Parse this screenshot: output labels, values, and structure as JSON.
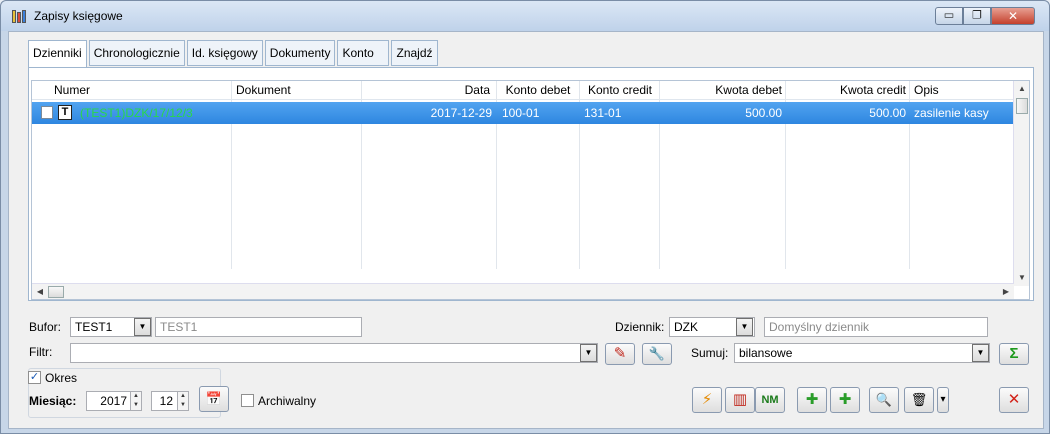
{
  "window": {
    "title": "Zapisy księgowe",
    "minimize_glyph": "▭",
    "restore_glyph": "❐",
    "close_glyph": "✕"
  },
  "tabs": [
    {
      "label": "Dzienniki",
      "active": true
    },
    {
      "label": "Chronologicznie"
    },
    {
      "label": "Id. księgowy"
    },
    {
      "label": "Dokumenty"
    },
    {
      "label": "Konto"
    },
    {
      "label": "Znajdź"
    }
  ],
  "grid": {
    "columns": [
      "Numer",
      "Dokument",
      "Data",
      "Konto debet",
      "Konto credit",
      "Kwota debet",
      "Kwota credit",
      "Opis"
    ],
    "rows": [
      {
        "type_badge": "T",
        "numer": "(TEST1)DZK/17/12/3",
        "dokument": "",
        "data": "2017-12-29",
        "konto_debet": "100-01",
        "konto_credit": "131-01",
        "kwota_debet": "500.00",
        "kwota_credit": "500.00",
        "opis": "zasilenie kasy"
      }
    ],
    "numer_color": "#29d84a",
    "selection_color": "#3d95e8"
  },
  "bufor": {
    "label": "Bufor:",
    "value": "TEST1",
    "description": "TEST1"
  },
  "dziennik": {
    "label": "Dziennik:",
    "value": "DZK",
    "placeholder": "Domyślny dziennik"
  },
  "filtr": {
    "label": "Filtr:",
    "value": ""
  },
  "sumuj": {
    "label": "Sumuj:",
    "value": "bilansowe"
  },
  "okres": {
    "label": "Okres",
    "checked": true
  },
  "miesiac": {
    "label": "Miesiąc:",
    "year": "2017",
    "month": "12"
  },
  "archiwalny": {
    "label": "Archiwalny",
    "checked": false
  },
  "icons": {
    "dropdown": "▼",
    "spin_up": "▲",
    "spin_down": "▼",
    "scroll_up": "▲",
    "scroll_down": "▼",
    "scroll_left": "◀",
    "scroll_right": "▶",
    "check": "✓",
    "calendar": "📅",
    "sigma": "Σ",
    "lightning": "⚡",
    "books": "▥",
    "nm": "NM",
    "add_folder": "✚",
    "add": "✚",
    "search": "🔍",
    "trash": "🗑",
    "more": "▾",
    "delete": "✕",
    "eraser": "✎",
    "wrench": "🔧"
  }
}
